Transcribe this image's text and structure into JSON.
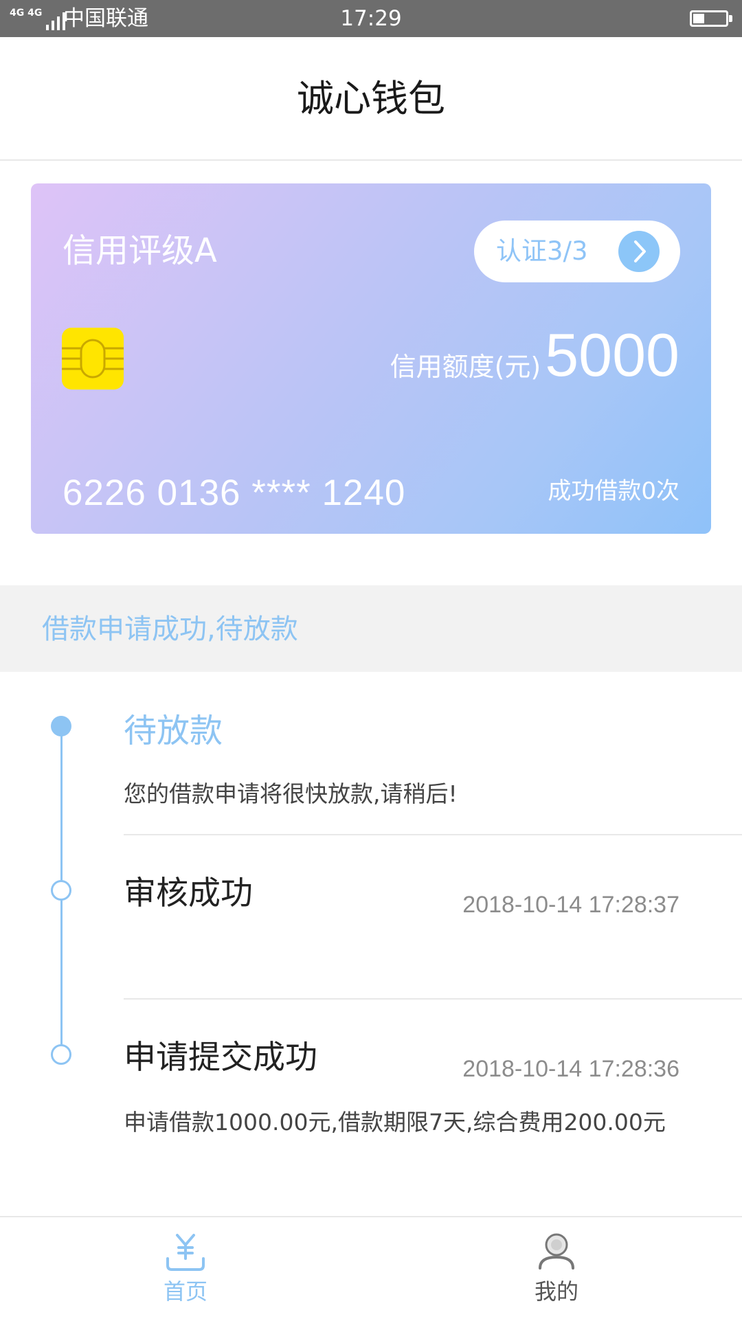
{
  "status_bar": {
    "network": "4G 4G",
    "carrier": "中国联通",
    "time": "17:29",
    "battery_level": 0.35
  },
  "header": {
    "title": "诚心钱包"
  },
  "card": {
    "rating": "信用评级A",
    "auth_label": "认证3/3",
    "limit_label": "信用额度(元)",
    "limit_amount": "5000",
    "card_number": "6226 0136 **** 1240",
    "loan_count": "成功借款0次",
    "chip_color": "#ffe500"
  },
  "banner": {
    "text": "借款申请成功,待放款"
  },
  "timeline": {
    "steps": [
      {
        "title": "待放款",
        "desc": "您的借款申请将很快放款,请稍后!",
        "status": "current"
      },
      {
        "title": "审核成功",
        "time": "2018-10-14 17:28:37",
        "status": "done"
      },
      {
        "title": "申请提交成功",
        "time": "2018-10-14 17:28:36",
        "desc": "申请借款1000.00元,借款期限7天,综合费用200.00元",
        "status": "done"
      }
    ]
  },
  "tabbar": {
    "items": [
      {
        "label": "首页",
        "icon": "yen-icon",
        "active": true
      },
      {
        "label": "我的",
        "icon": "user-icon",
        "active": false
      }
    ]
  },
  "colors": {
    "accent": "#8dc4f3",
    "status_bar": "#6d6d6d",
    "card_gradient_start": "#dec3f7",
    "card_gradient_end": "#8fc2f9"
  }
}
